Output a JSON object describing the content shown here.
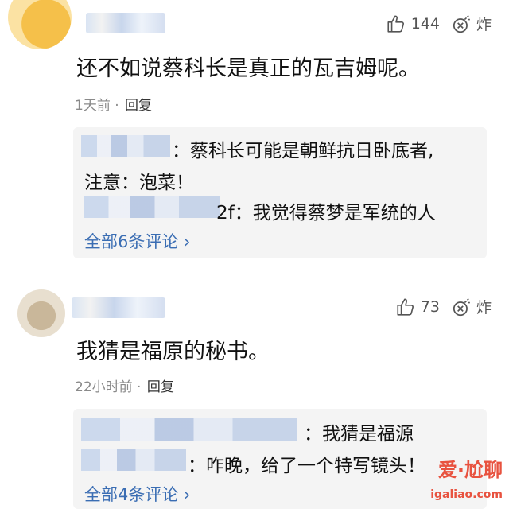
{
  "comments": [
    {
      "likes": "144",
      "react_label": "炸",
      "text": "还不如说蔡科长是真正的瓦吉姆呢。",
      "time": "1天前",
      "sep": "·",
      "reply_label": "回复",
      "replies": [
        {
          "text": "：蔡科长可能是朝鲜抗日卧底者,"
        },
        {
          "text": "注意：泡菜！"
        },
        {
          "text": "2f：我觉得蔡梦是军统的人"
        }
      ],
      "expand_label": "全部6条评论 ›"
    },
    {
      "likes": "73",
      "react_label": "炸",
      "text": "我猜是福原的秘书。",
      "time": "22小时前",
      "sep": "·",
      "reply_label": "回复",
      "replies": [
        {
          "text": "：我猜是福源"
        },
        {
          "text": "：咋晚，给了一个特写镜头！"
        }
      ],
      "expand_label": "全部4条评论 ›"
    }
  ],
  "watermark": {
    "text": "爱·尬聊",
    "url": "igaliao.com"
  },
  "colors": {
    "link": "#3a6db3",
    "meta": "#8a8a8a",
    "reply_bg": "#f4f4f4"
  }
}
